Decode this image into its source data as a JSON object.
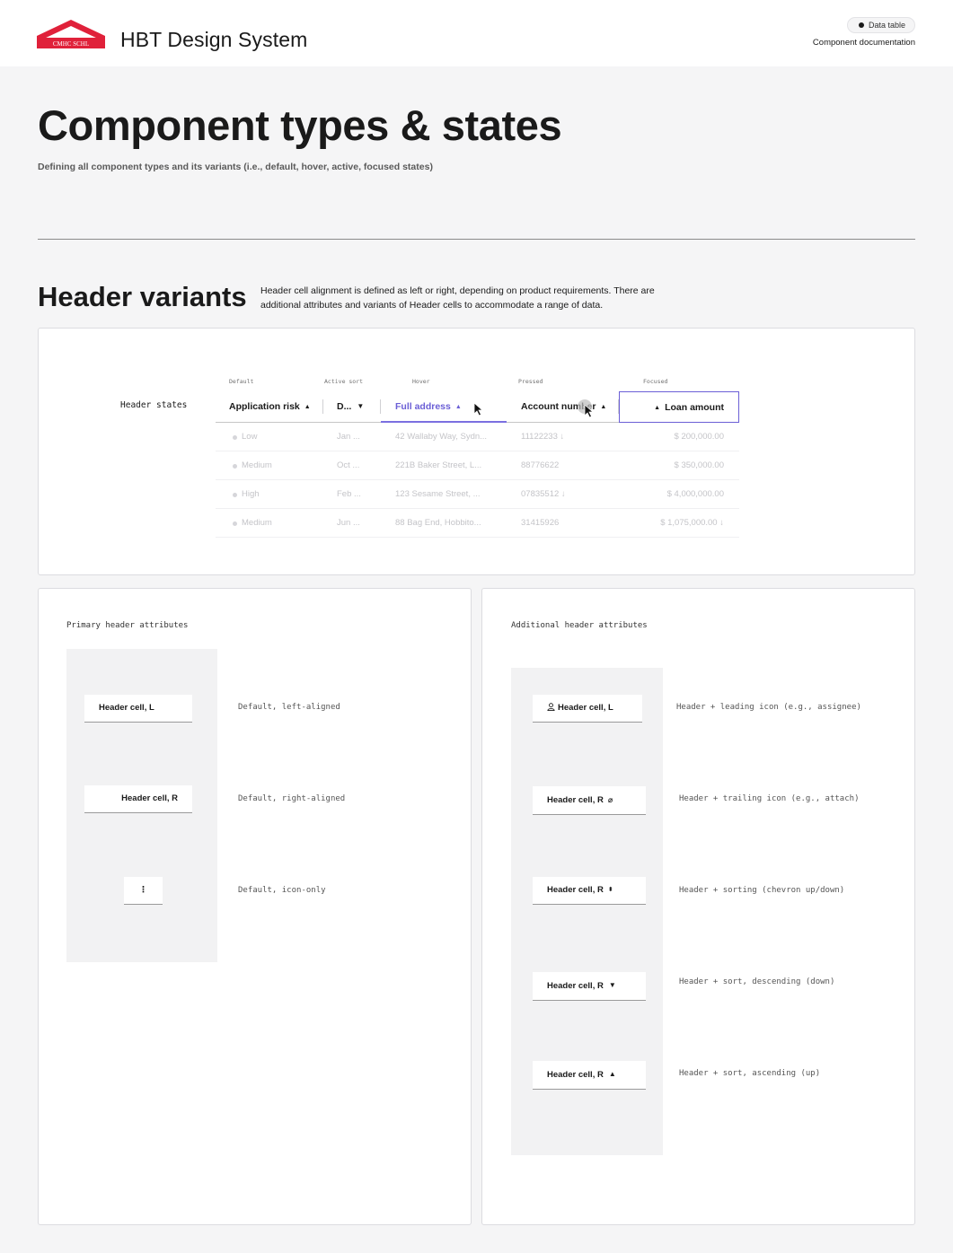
{
  "header": {
    "brand": "HBT Design System",
    "logo_text": "CMHC SCHL",
    "badge": "Data table",
    "doc_label": "Component documentation"
  },
  "page": {
    "title": "Component types & states",
    "subtitle": "Defining all component types and its variants (i.e., default, hover, active, focused states)"
  },
  "section": {
    "title": "Header variants",
    "description": "Header cell alignment is defined as left or right, depending on product requirements. There are additional attributes and variants of Header cells to accommodate a range of data."
  },
  "states": {
    "row_label": "Header states",
    "labels": [
      "Default",
      "Active sort",
      "Hover",
      "Pressed",
      "Focused"
    ],
    "headers": [
      "Application risk",
      "D...",
      "Full address",
      "Account number",
      "Loan amount"
    ],
    "rows": [
      [
        "Low",
        "Jan ...",
        "42 Wallaby Way, Sydn...",
        "11122233",
        "$ 200,000.00"
      ],
      [
        "Medium",
        "Oct ...",
        "221B Baker Street, L...",
        "88776622",
        "$ 350,000.00"
      ],
      [
        "High",
        "Feb ...",
        "123 Sesame Street, ...",
        "07835512",
        "$ 4,000,000.00"
      ],
      [
        "Medium",
        "Jun ...",
        "88 Bag End, Hobbito...",
        "31415926",
        "$ 1,075,000.00"
      ]
    ]
  },
  "primary": {
    "title": "Primary header attributes",
    "items": [
      {
        "label": "Header cell, L",
        "desc": "Default, left-aligned"
      },
      {
        "label": "Header cell, R",
        "desc": "Default, right-aligned"
      },
      {
        "label": "⋮",
        "desc": "Default, icon-only"
      }
    ]
  },
  "additional": {
    "title": "Additional header attributes",
    "items": [
      {
        "label": "Header cell, L",
        "desc": "Header + leading icon (e.g., assignee)",
        "icon": "person-icon"
      },
      {
        "label": "Header cell, R",
        "desc": "Header + trailing icon (e.g., attach)",
        "icon": "paperclip-icon"
      },
      {
        "label": "Header cell, R",
        "desc": "Header + sorting (chevron up/down)",
        "icon": "sort-icon"
      },
      {
        "label": "Header cell, R",
        "desc": "Header + sort, descending (down)",
        "icon": "caret-down-icon"
      },
      {
        "label": "Header cell, R",
        "desc": "Header + sort, ascending (up)",
        "icon": "caret-up-icon"
      }
    ]
  },
  "colors": {
    "accent": "#6b5fd6",
    "brand_red": "#e0213a",
    "background": "#f5f5f6"
  }
}
